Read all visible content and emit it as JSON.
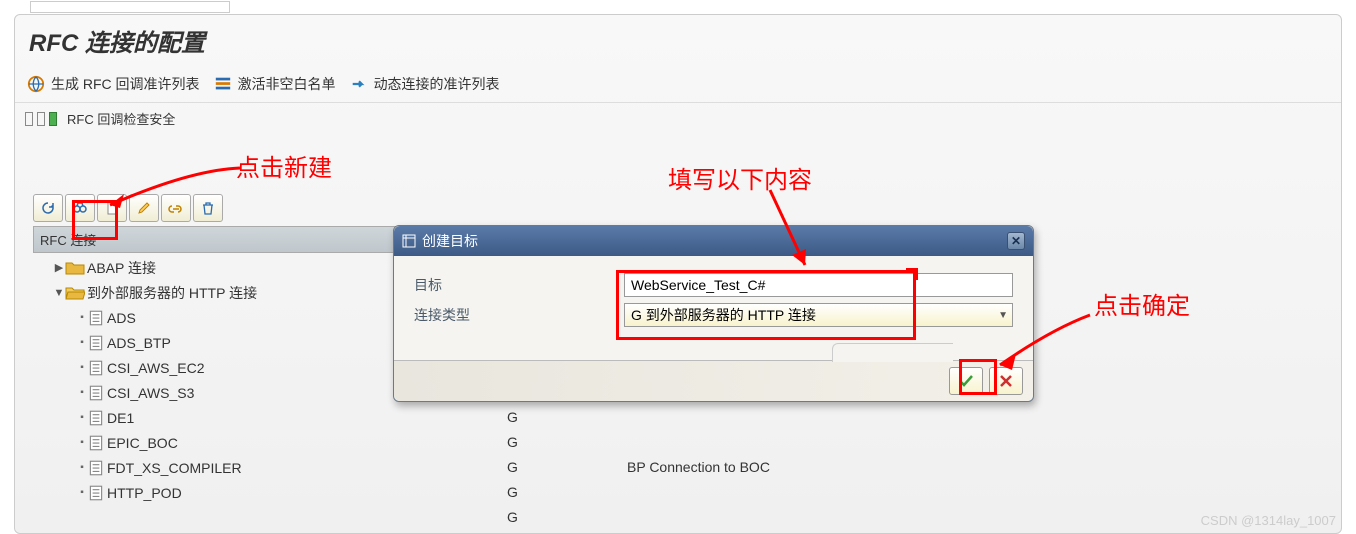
{
  "page_title": "RFC 连接的配置",
  "header_links": [
    {
      "label": "生成 RFC 回调准许列表",
      "icon": "globe-icon"
    },
    {
      "label": "激活非空白名单",
      "icon": "list-icon"
    },
    {
      "label": "动态连接的准许列表",
      "icon": "arrow-right-icon"
    }
  ],
  "status_text": "RFC 回调检查安全",
  "annotations": {
    "a1": "点击新建",
    "a2": "填写以下内容",
    "a3": "点击确定"
  },
  "tree_header": "RFC 连接",
  "tree": {
    "node1": {
      "label": "ABAP 连接"
    },
    "node2": {
      "label": "到外部服务器的 HTTP 连接"
    },
    "leaves": [
      "ADS",
      "ADS_BTP",
      "CSI_AWS_EC2",
      "CSI_AWS_S3",
      "DE1",
      "EPIC_BOC",
      "FDT_XS_COMPILER",
      "HTTP_POD"
    ]
  },
  "grid": {
    "rows": [
      {
        "g": "G",
        "desc": ""
      },
      {
        "g": "G",
        "desc": ""
      },
      {
        "g": "G",
        "desc": "BP Connection to BOC"
      },
      {
        "g": "G",
        "desc": ""
      },
      {
        "g": "G",
        "desc": ""
      }
    ]
  },
  "dialog": {
    "title": "创建目标",
    "f_target_label": "目标",
    "f_target_value": "WebService_Test_C#",
    "f_type_label": "连接类型",
    "f_type_value": "G 到外部服务器的 HTTP 连接"
  },
  "watermark": "CSDN @1314lay_1007"
}
